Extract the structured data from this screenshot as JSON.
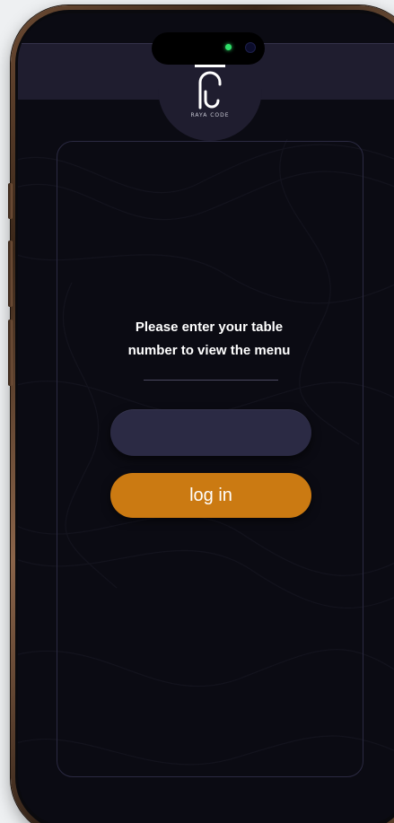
{
  "logo": {
    "brand_text": "RAYA CODE"
  },
  "login": {
    "prompt_line1": "Please enter your table",
    "prompt_line2": "number to view the menu",
    "table_input_value": "",
    "button_label": "log in"
  },
  "colors": {
    "screen_bg": "#0b0b13",
    "header_bg": "#1f1d2f",
    "input_bg": "#2b2a44",
    "accent": "#cb7a12",
    "camera_indicator": "#2fe06a",
    "frame": "#6b4a33"
  },
  "icons": {
    "logo": "raya-code-logo-icon",
    "camera": "camera-indicator-icon"
  }
}
